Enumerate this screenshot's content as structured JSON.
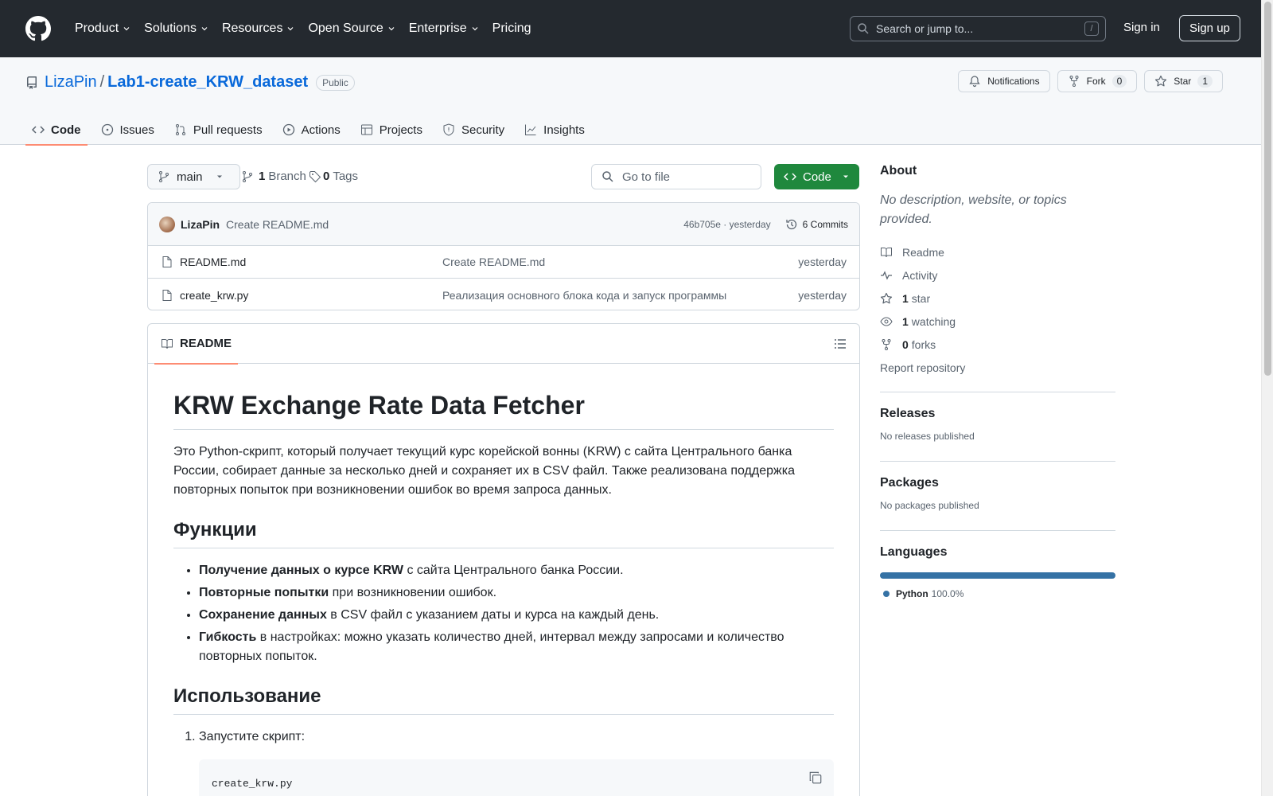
{
  "topnav": {
    "items": [
      "Product",
      "Solutions",
      "Resources",
      "Open Source",
      "Enterprise",
      "Pricing"
    ],
    "search_placeholder": "Search or jump to...",
    "search_key": "/",
    "signin": "Sign in",
    "signup": "Sign up"
  },
  "repo": {
    "owner": "LizaPin",
    "separator": "/",
    "name": "Lab1-create_KRW_dataset",
    "visibility": "Public",
    "notifications_label": "Notifications",
    "fork_label": "Fork",
    "fork_count": "0",
    "star_label": "Star",
    "star_count": "1"
  },
  "tabs": [
    {
      "label": "Code",
      "icon": "code-icon"
    },
    {
      "label": "Issues",
      "icon": "issue-icon"
    },
    {
      "label": "Pull requests",
      "icon": "pull-request-icon"
    },
    {
      "label": "Actions",
      "icon": "play-icon"
    },
    {
      "label": "Projects",
      "icon": "table-icon"
    },
    {
      "label": "Security",
      "icon": "shield-icon"
    },
    {
      "label": "Insights",
      "icon": "graph-icon"
    }
  ],
  "toolbar": {
    "branch": "main",
    "branch_count": "1",
    "branch_label": "Branch",
    "tag_count": "0",
    "tag_label": "Tags",
    "goto_placeholder": "Go to file",
    "code_button": "Code"
  },
  "commit": {
    "author": "LizaPin",
    "message": "Create README.md",
    "hash": "46b705e",
    "separator": " · ",
    "time": "yesterday",
    "commits_label": "6 Commits"
  },
  "files": [
    {
      "name": "README.md",
      "message": "Create README.md",
      "time": "yesterday"
    },
    {
      "name": "create_krw.py",
      "message": "Реализация основного блока кода и запуск программы",
      "time": "yesterday"
    }
  ],
  "readme": {
    "tab_label": "README",
    "h1": "KRW Exchange Rate Data Fetcher",
    "intro": "Это Python-скрипт, который получает текущий курс корейской вонны (KRW) с сайта Центрального банка России, собирает данные за несколько дней и сохраняет их в CSV файл. Также реализована поддержка повторных попыток при возникновении ошибок во время запроса данных.",
    "h2_functions": "Функции",
    "features": [
      {
        "bold": "Получение данных о курсе KRW",
        "text": " с сайта Центрального банка России."
      },
      {
        "bold": "Повторные попытки",
        "text": " при возникновении ошибок."
      },
      {
        "bold": "Сохранение данных",
        "text": " в CSV файл с указанием даты и курса на каждый день."
      },
      {
        "bold": "Гибкость",
        "text": " в настройках: можно указать количество дней, интервал между запросами и количество повторных попыток."
      }
    ],
    "h2_usage": "Использование",
    "steps": [
      "Запустите скрипт:"
    ],
    "code": "create_krw.py"
  },
  "sidebar": {
    "about_title": "About",
    "about_desc": "No description, website, or topics provided.",
    "links": [
      {
        "icon": "book-icon",
        "count": "",
        "label": "Readme"
      },
      {
        "icon": "pulse-icon",
        "count": "",
        "label": "Activity"
      },
      {
        "icon": "star-icon",
        "count": "1",
        "label": "star"
      },
      {
        "icon": "eye-icon",
        "count": "1",
        "label": "watching"
      },
      {
        "icon": "fork-icon",
        "count": "0",
        "label": "forks"
      }
    ],
    "report": "Report repository",
    "releases_title": "Releases",
    "releases_empty": "No releases published",
    "packages_title": "Packages",
    "packages_empty": "No packages published",
    "languages_title": "Languages",
    "language": "Python",
    "language_pct": "100.0%",
    "language_share": 1.0,
    "language_color": "#3572a5"
  },
  "colors": {
    "header_bg": "#24292f",
    "link": "#0969da",
    "primary_button": "#1f883d",
    "active_tab_underline": "#fd8c73"
  }
}
